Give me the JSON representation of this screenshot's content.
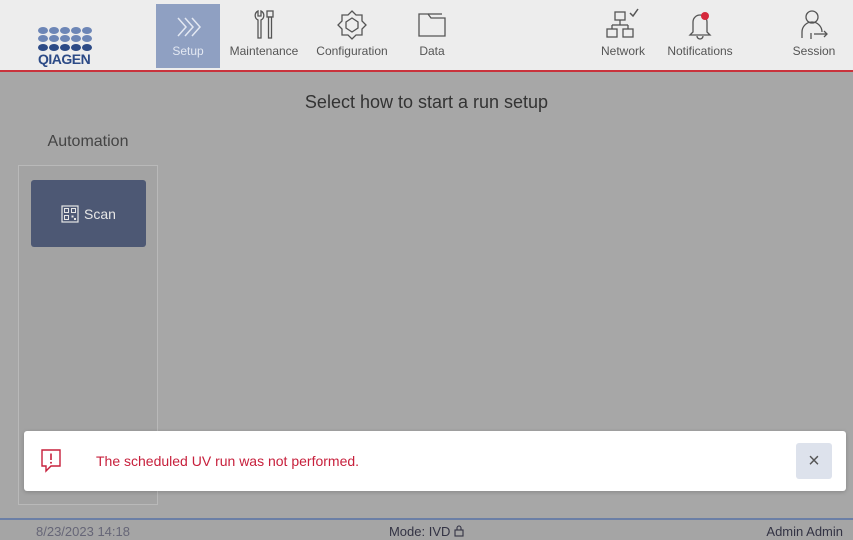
{
  "brand": {
    "logo_text": "QIAGEN"
  },
  "nav": {
    "setup": "Setup",
    "maintenance": "Maintenance",
    "configuration": "Configuration",
    "data": "Data",
    "network": "Network",
    "notifications": "Notifications",
    "session": "Session"
  },
  "main": {
    "title": "Select how to start a run setup",
    "automation_label": "Automation",
    "scan_label": "Scan"
  },
  "toast": {
    "message": "The scheduled UV run was not performed.",
    "close_glyph": "×"
  },
  "status": {
    "datetime": "8/23/2023 14:18",
    "mode": "Mode: IVD",
    "user": "Admin Admin"
  },
  "colors": {
    "accent_red": "#c9333c",
    "active_tab": "#8fa0c2",
    "scan_button": "#4d5874",
    "error_text": "#c7203c"
  },
  "icons": [
    "chevrons-right-icon",
    "tools-icon",
    "gear-icon",
    "folder-icon",
    "network-icon",
    "bell-icon",
    "session-icon",
    "qr-code-icon",
    "warning-icon",
    "close-icon",
    "lock-icon"
  ]
}
